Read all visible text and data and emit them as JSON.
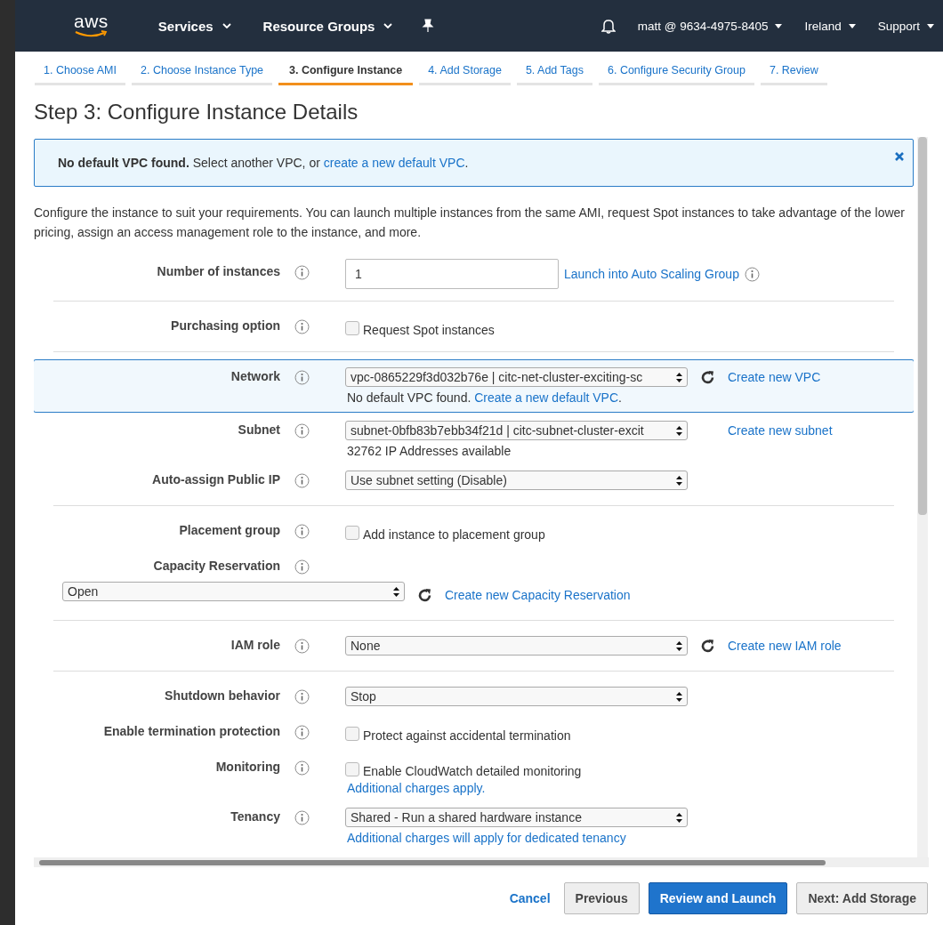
{
  "nav": {
    "logo": "aws",
    "menus": [
      {
        "label": "Services"
      },
      {
        "label": "Resource Groups"
      }
    ],
    "account_menus": [
      {
        "label": "matt @ 9634-4975-8405"
      },
      {
        "label": "Ireland"
      },
      {
        "label": "Support"
      }
    ]
  },
  "steps": [
    {
      "label": "1. Choose AMI",
      "selected": false
    },
    {
      "label": "2. Choose Instance Type",
      "selected": false
    },
    {
      "label": "3. Configure Instance",
      "selected": true
    },
    {
      "label": "4. Add Storage",
      "selected": false
    },
    {
      "label": "5. Add Tags",
      "selected": false
    },
    {
      "label": "6. Configure Security Group",
      "selected": false
    },
    {
      "label": "7. Review",
      "selected": false
    }
  ],
  "title": "Step 3: Configure Instance Details",
  "alert": {
    "text": "**No default VPC found.** Select another VPC, or ",
    "link": "create a new default VPC",
    "end": "."
  },
  "intro": "Configure the instance to suit your requirements. You can launch multiple instances from the same AMI, request Spot instances to take advantage of the lower pricing, assign an access management role to the instance, and more.",
  "rows": [
    {
      "label": "Number of instances",
      "control": {
        "kind": "input",
        "value": "1"
      },
      "link": "Launch into Auto Scaling Group",
      "link_info": true,
      "divider": true
    },
    {
      "label": "Purchasing option",
      "control": {
        "kind": "checkbox",
        "label": "Request Spot instances",
        "checked": false
      },
      "divider": true
    },
    {
      "label": "Network",
      "highlighted": true,
      "control": {
        "kind": "select",
        "value": "vpc-0865229f3d032b76e | citc-net-cluster-exciting-sc"
      },
      "refresh": true,
      "link": "Create new VPC",
      "note": {
        "text": "No default VPC found. ",
        "link": "Create a new default VPC",
        "end": "."
      }
    },
    {
      "label": "Subnet",
      "control": {
        "kind": "select",
        "value": "subnet-0bfb83b7ebb34f21d | citc-subnet-cluster-excit"
      },
      "refresh": false,
      "link": "Create new subnet",
      "note": {
        "text": "32762 IP Addresses available"
      }
    },
    {
      "label": "Auto-assign Public IP",
      "control": {
        "kind": "select",
        "value": "Use subnet setting (Disable)"
      },
      "divider": true
    },
    {
      "label": "Placement group",
      "control": {
        "kind": "checkbox",
        "label": "Add instance to placement group",
        "checked": false
      }
    },
    {
      "label": "Capacity Reservation",
      "wide": true,
      "control": {
        "kind": "select",
        "value": "Open"
      },
      "refresh": true,
      "link": "Create new Capacity Reservation",
      "divider": true
    },
    {
      "label": "IAM role",
      "control": {
        "kind": "select",
        "value": "None"
      },
      "refresh": true,
      "link": "Create new IAM role",
      "divider": true
    },
    {
      "label": "Shutdown behavior",
      "control": {
        "kind": "select",
        "value": "Stop"
      }
    },
    {
      "label": "Enable termination protection",
      "control": {
        "kind": "checkbox",
        "label": "Protect against accidental termination",
        "checked": false
      }
    },
    {
      "label": "Monitoring",
      "control": {
        "kind": "checkbox",
        "label": "Enable CloudWatch detailed monitoring",
        "checked": false
      },
      "note": {
        "link": "Additional charges apply."
      }
    },
    {
      "label": "Tenancy",
      "control": {
        "kind": "select",
        "value": "Shared - Run a shared hardware instance"
      },
      "note": {
        "link": "Additional charges will apply for dedicated tenancy"
      }
    }
  ],
  "footer": {
    "cancel": "Cancel",
    "buttons": [
      {
        "label": "Previous",
        "kind": "secondary"
      },
      {
        "label": "Review and Launch",
        "kind": "primary"
      },
      {
        "label": "Next: Add Storage",
        "kind": "secondary"
      }
    ]
  }
}
